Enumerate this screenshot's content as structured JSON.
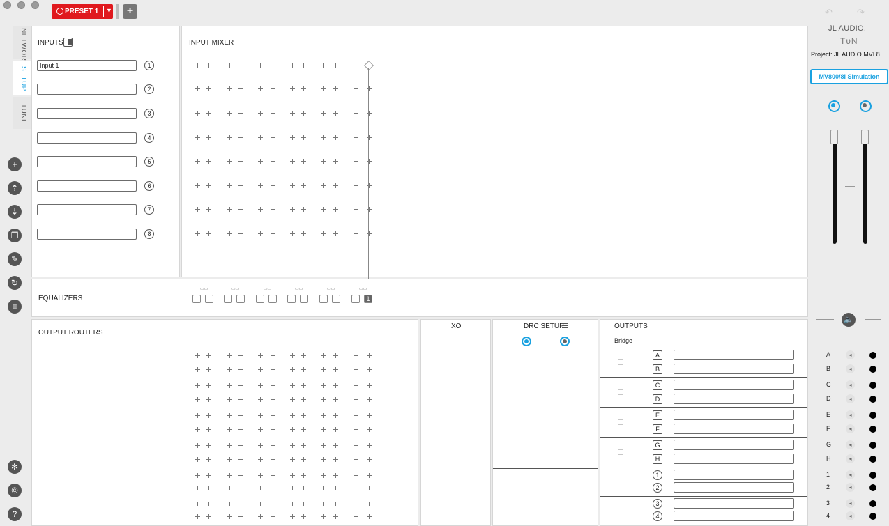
{
  "toolbar": {
    "preset_label": "PRESET 1",
    "add_label": "+"
  },
  "brand": {
    "name": "JL AUDIO.",
    "product": "TᴜN",
    "project": "Project: JL AUDIO MVI 8...",
    "simulation_button": "MV800/8i Simulation"
  },
  "side_tabs": {
    "network": "NETWORK",
    "setup": "SETUP",
    "tune": "TUNE"
  },
  "side_icons": [
    "add-icon",
    "upload-icon",
    "download-icon",
    "copy-icon",
    "wrench-icon",
    "refresh-icon",
    "list-icon",
    "settings-icon",
    "copyright-icon",
    "help-icon"
  ],
  "inputs": {
    "title": "INPUTS",
    "rows": [
      {
        "value": "Input 1",
        "num": "1"
      },
      {
        "value": "",
        "num": "2"
      },
      {
        "value": "",
        "num": "3"
      },
      {
        "value": "",
        "num": "4"
      },
      {
        "value": "",
        "num": "5"
      },
      {
        "value": "",
        "num": "6"
      },
      {
        "value": "",
        "num": "7"
      },
      {
        "value": "",
        "num": "8"
      }
    ]
  },
  "input_mixer": {
    "title": "INPUT MIXER"
  },
  "equalizers": {
    "title": "EQUALIZERS",
    "selected_label": "1"
  },
  "output_routers": {
    "title": "OUTPUT ROUTERS"
  },
  "xo": {
    "title": "XO"
  },
  "drc": {
    "title": "DRC SETUP"
  },
  "outputs": {
    "title": "OUTPUTS",
    "bridge_label": "Bridge",
    "channels": [
      "A",
      "B",
      "C",
      "D",
      "E",
      "F",
      "G",
      "H",
      "1",
      "2",
      "3",
      "4"
    ]
  },
  "meters": {
    "left_level": 0.0,
    "right_level": 0.0
  },
  "colors": {
    "accent": "#1aa1e0",
    "preset_red": "#e0191e"
  }
}
